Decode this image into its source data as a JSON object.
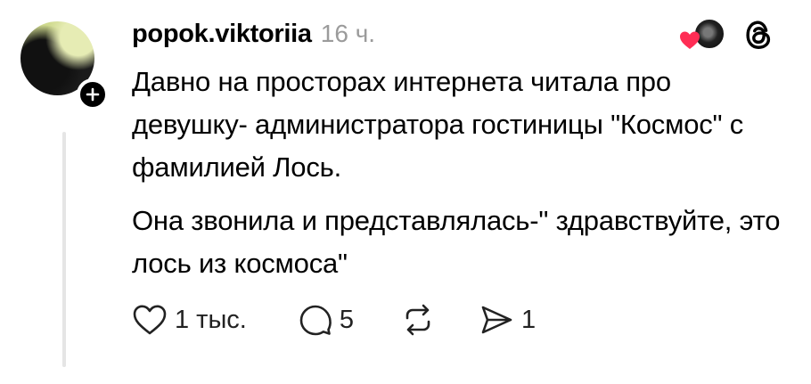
{
  "post": {
    "username": "popok.viktoriia",
    "time": "16 ч.",
    "paragraphs": [
      "Давно на просторах интернета читала про девушку- администратора гостиницы \"Космос\" с фамилией Лось.",
      "Она звонила и представлялась-\" здравствуйте, это лось из космоса\""
    ]
  },
  "actions": {
    "likes": "1 тыс.",
    "comments": "5",
    "reposts": "",
    "shares": "1"
  },
  "icons": {
    "like": "heart-outline-icon",
    "comment": "speech-bubble-icon",
    "repost": "repost-arrows-icon",
    "share": "send-icon",
    "follow": "plus-icon",
    "app": "threads-logo-icon",
    "liked_by": "red-heart-icon"
  },
  "colors": {
    "liked_heart": "#ff2d55",
    "muted_text": "#9b9b9b",
    "thread_line": "#e5e5e5"
  }
}
